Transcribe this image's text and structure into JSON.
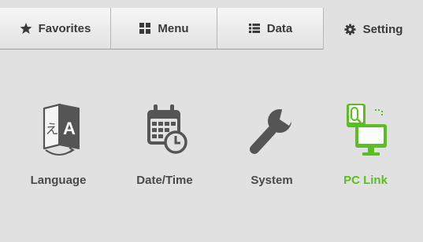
{
  "tabs": [
    {
      "label": "Favorites",
      "icon": "star-icon",
      "active": false
    },
    {
      "label": "Menu",
      "icon": "grid-icon",
      "active": false
    },
    {
      "label": "Data",
      "icon": "list-icon",
      "active": false
    },
    {
      "label": "Setting",
      "icon": "gear-icon",
      "active": true
    }
  ],
  "settings": [
    {
      "label": "Language",
      "icon": "language-icon"
    },
    {
      "label": "Date/Time",
      "icon": "calendar-clock-icon"
    },
    {
      "label": "System",
      "icon": "wrench-icon"
    },
    {
      "label": "PC Link",
      "icon": "pc-link-icon",
      "selected": true
    }
  ],
  "colors": {
    "background": "#e1e1e1",
    "text": "#4a4a4a",
    "accent": "#5cbd24"
  }
}
